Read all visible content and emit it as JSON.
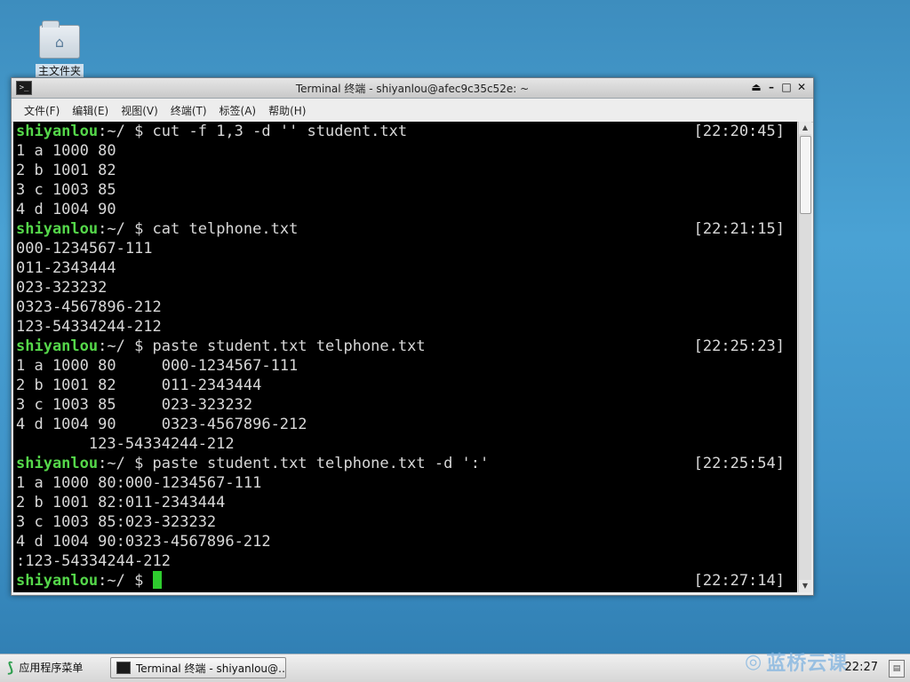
{
  "desktop": {
    "icons": [
      {
        "label": "主文件夹",
        "icon": "home-folder-icon"
      }
    ]
  },
  "window": {
    "title": "Terminal 终端 - shiyanlou@afec9c35c52e: ~",
    "controls": {
      "shade": "⏏",
      "minimize": "–",
      "maximize": "□",
      "close": "✕"
    },
    "menu": [
      {
        "label": "文件(F)"
      },
      {
        "label": "编辑(E)"
      },
      {
        "label": "视图(V)"
      },
      {
        "label": "终端(T)"
      },
      {
        "label": "标签(A)"
      },
      {
        "label": "帮助(H)"
      }
    ]
  },
  "terminal": {
    "prompt_user": "shiyanlou",
    "prompt_path": ":~/ $ ",
    "lines": [
      {
        "cmd": "cut -f 1,3 -d '' student.txt",
        "ts": "[22:20:45]"
      },
      {
        "text": "1 a 1000 80"
      },
      {
        "text": "2 b 1001 82"
      },
      {
        "text": "3 c 1003 85"
      },
      {
        "text": "4 d 1004 90"
      },
      {
        "cmd": "cat telphone.txt",
        "ts": "[22:21:15]"
      },
      {
        "text": "000-1234567-111"
      },
      {
        "text": "011-2343444"
      },
      {
        "text": "023-323232"
      },
      {
        "text": "0323-4567896-212"
      },
      {
        "text": "123-54334244-212"
      },
      {
        "cmd": "paste student.txt telphone.txt",
        "ts": "[22:25:23]"
      },
      {
        "text": "1 a 1000 80     000-1234567-111"
      },
      {
        "text": "2 b 1001 82     011-2343444"
      },
      {
        "text": "3 c 1003 85     023-323232"
      },
      {
        "text": "4 d 1004 90     0323-4567896-212"
      },
      {
        "text": "        123-54334244-212"
      },
      {
        "cmd": "paste student.txt telphone.txt -d ':'",
        "ts": "[22:25:54]"
      },
      {
        "text": "1 a 1000 80:000-1234567-111"
      },
      {
        "text": "2 b 1001 82:011-2343444"
      },
      {
        "text": "3 c 1003 85:023-323232"
      },
      {
        "text": "4 d 1004 90:0323-4567896-212"
      },
      {
        "text": ":123-54334244-212"
      },
      {
        "cmd": "",
        "ts": "[22:27:14]",
        "cursor": true
      }
    ]
  },
  "taskbar": {
    "start_label": "应用程序菜单",
    "task_label": "Terminal 终端 - shiyanlou@…",
    "watermark": "蓝桥云课",
    "clock": "22:27"
  },
  "colors": {
    "prompt_user": "#55d74a",
    "cursor": "#2ecc2e",
    "terminal_bg": "#000000",
    "terminal_fg": "#d8d8d8"
  }
}
